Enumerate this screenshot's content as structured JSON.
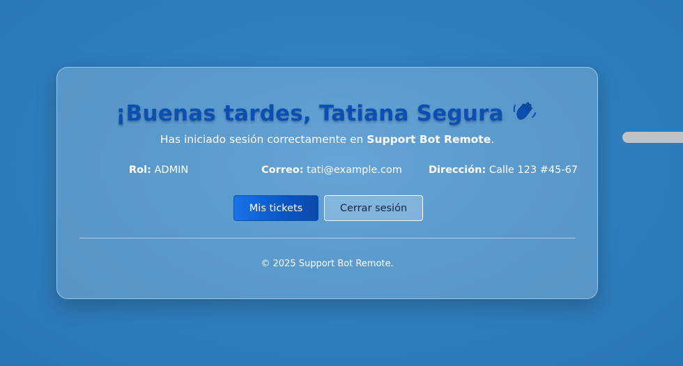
{
  "greeting": {
    "text": "¡Buenas tardes, Tatiana Segura",
    "icon": "waving-hand-icon"
  },
  "subtitle": {
    "prefix": "Has iniciado sesión correctamente en ",
    "app_name": "Support Bot Remote",
    "suffix": "."
  },
  "user_info": {
    "rol": {
      "label": "Rol:",
      "value": "ADMIN"
    },
    "correo": {
      "label": "Correo:",
      "value": "tati@example.com"
    },
    "direccion": {
      "label": "Dirección:",
      "value": "Calle 123 #45-67"
    }
  },
  "actions": {
    "tickets_label": "Mis tickets",
    "logout_label": "Cerrar sesión"
  },
  "footer": {
    "text": "© 2025 Support Bot Remote."
  },
  "colors": {
    "background": "#3180bf",
    "greeting": "#0d4fb0",
    "primary_button": "#0a58c9",
    "scroll_handle": "#bfc2c6"
  }
}
